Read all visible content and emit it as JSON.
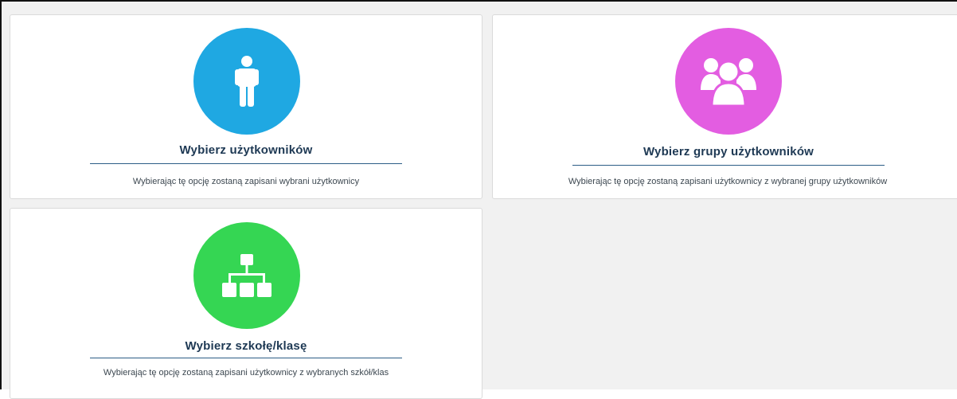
{
  "colors": {
    "users_circle": "#1fa8e2",
    "groups_circle": "#e35de1",
    "school_circle": "#35d653",
    "title_text": "#1e3954",
    "divider": "#2c5d86",
    "description_text": "#3c4750",
    "background": "#f1f1f1",
    "card_background": "#ffffff"
  },
  "options": [
    {
      "icon": "user-icon",
      "title": "Wybierz użytkowników",
      "description": "Wybierając tę opcję zostaną zapisani wybrani użytkownicy"
    },
    {
      "icon": "user-group-icon",
      "title": "Wybierz grupy użytkowników",
      "description": "Wybierając tę opcję zostaną zapisani użytkownicy z wybranej grupy użytkowników"
    },
    {
      "icon": "sitemap-icon",
      "title": "Wybierz szkołę/klasę",
      "description": "Wybierając tę opcję zostaną zapisani użytkownicy z wybranych szkół/klas"
    }
  ]
}
